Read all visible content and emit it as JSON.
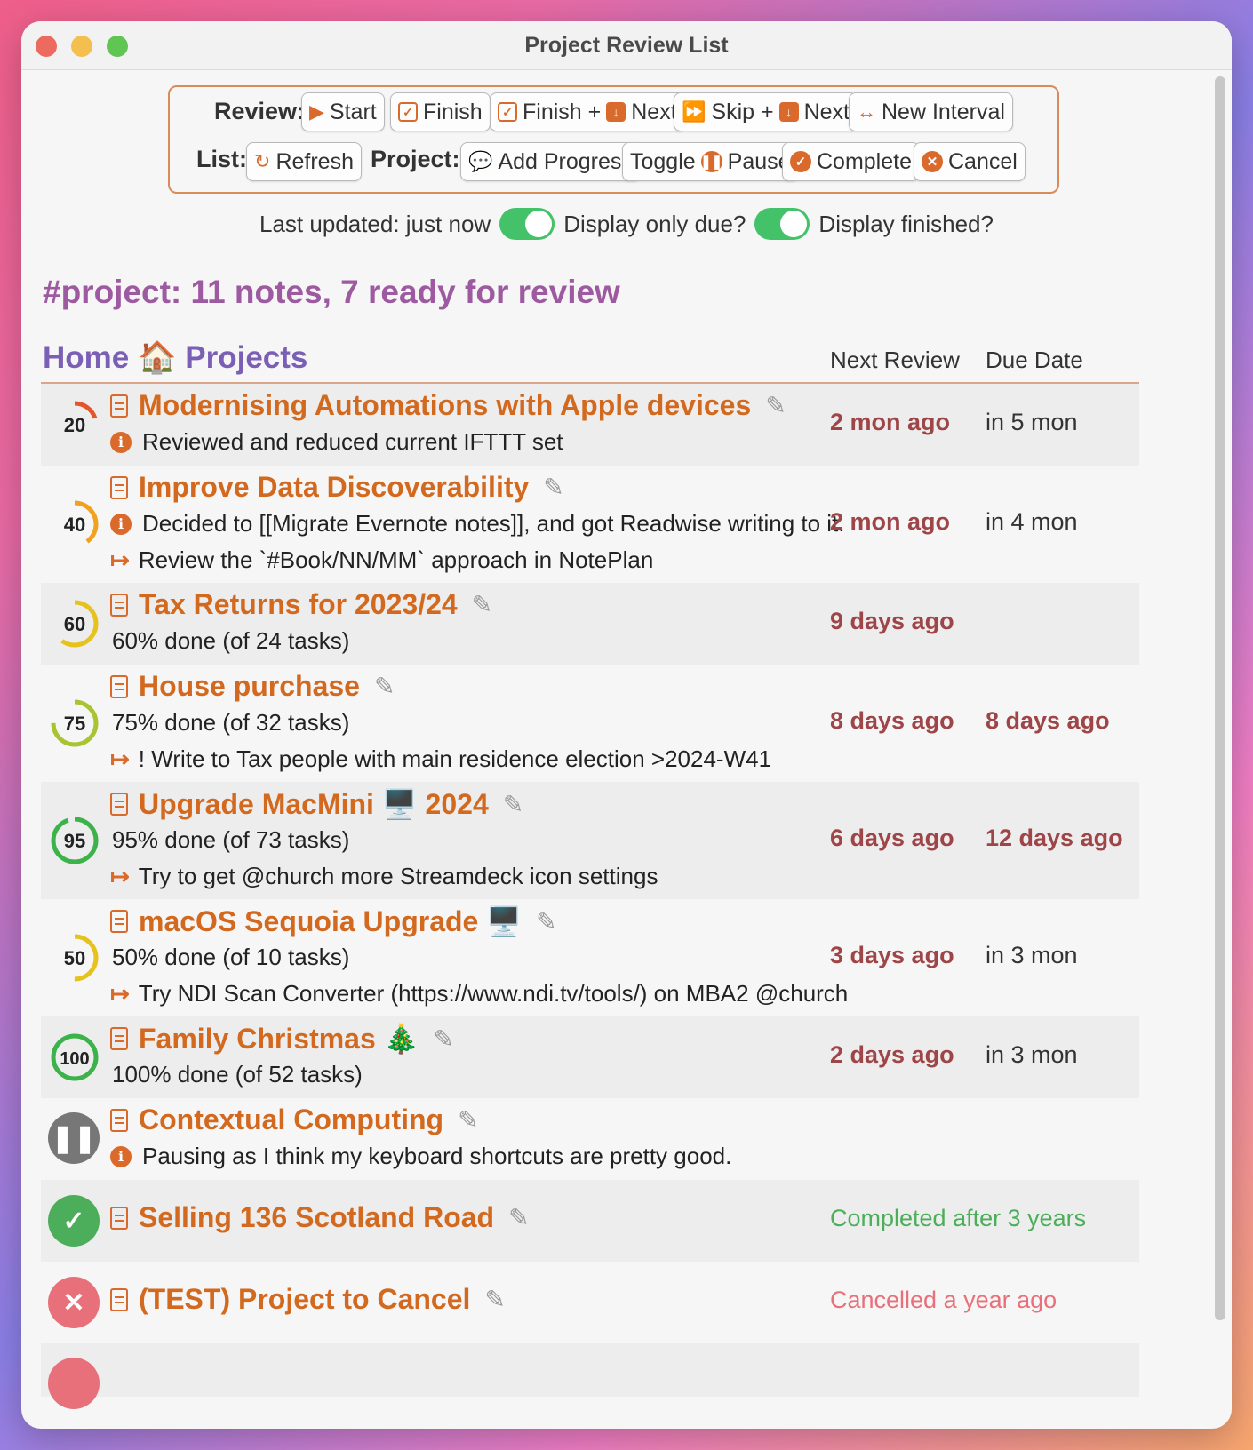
{
  "window": {
    "title": "Project Review List"
  },
  "toolbar": {
    "review_label": "Review:",
    "list_label": "List:",
    "project_label": "Project::",
    "start": "Start",
    "finish": "Finish",
    "finish_next": "Finish + ",
    "next": "Next",
    "skip_next": "Skip + ",
    "next2": "Next",
    "new_interval": "New Interval",
    "refresh": "Refresh",
    "add_progress": "Add Progress",
    "toggle": "Toggle",
    "pause": "Pause",
    "complete": "Complete",
    "cancel": "Cancel"
  },
  "status": {
    "last_updated": "Last updated: just now",
    "display_only_due": "Display only due?",
    "display_finished": "Display finished?",
    "display_only_due_on": true,
    "display_finished_on": true
  },
  "summary": "#project: 11 notes, 7 ready for review",
  "folder": {
    "name": "Home 🏠 Projects"
  },
  "columns": {
    "next_review": "Next Review",
    "due_date": "Due Date"
  },
  "projects": [
    {
      "title": "Modernising Automations with Apple devices",
      "progress": 20,
      "note": "Reviewed and reduced current IFTTT set",
      "next_review": "2 mon ago",
      "due": "in 5 mon"
    },
    {
      "title": "Improve Data Discoverability",
      "progress": 40,
      "note": "Decided to [[Migrate Evernote notes]], and got Readwise writing to it.",
      "next_action": "Review the `#Book/NN/MM` approach in NotePlan",
      "next_review": "2 mon ago",
      "due": "in 4 mon"
    },
    {
      "title": "Tax Returns for 2023/24",
      "progress": 60,
      "progress_text": "60% done (of 24 tasks)",
      "next_review": "9 days ago",
      "due": ""
    },
    {
      "title": "House purchase",
      "progress": 75,
      "progress_text": "75% done (of 32 tasks)",
      "next_action": "! Write to Tax people with main residence election >2024-W41",
      "next_review": "8 days ago",
      "due": "8 days ago"
    },
    {
      "title": "Upgrade MacMini 🖥️ 2024",
      "progress": 95,
      "progress_text": "95% done (of 73 tasks)",
      "next_action": "Try to get @church more Streamdeck icon settings",
      "next_review": "6 days ago",
      "due": "12 days ago"
    },
    {
      "title": "macOS Sequoia Upgrade 🖥️",
      "progress": 50,
      "progress_text": "50% done (of 10 tasks)",
      "next_action": "Try NDI Scan Converter (https://www.ndi.tv/tools/) on MBA2 @church",
      "next_review": "3 days ago",
      "due": "in 3 mon"
    },
    {
      "title": "Family Christmas 🎄",
      "progress": 100,
      "progress_text": "100% done (of 52 tasks)",
      "next_review": "2 days ago",
      "due": "in 3 mon"
    },
    {
      "title": "Contextual Computing",
      "state": "paused",
      "note": "Pausing as I think my keyboard shortcuts are pretty good."
    },
    {
      "title": "Selling 136 Scotland Road",
      "state": "completed",
      "status_text": "Completed after 3 years"
    },
    {
      "title": "(TEST) Project to Cancel",
      "state": "cancelled",
      "status_text": "Cancelled a year ago"
    }
  ],
  "colors": {
    "accent": "#d96a2b",
    "title": "#d2691e",
    "overdue": "#9e4548",
    "summary": "#9d5aa0",
    "folder": "#7a5fb5",
    "completed": "#4cae5a",
    "cancelled": "#e8707a",
    "paused": "#777777",
    "toggle_on": "#44c26a"
  },
  "icons": {
    "start": "play-icon",
    "finish": "calendar-check-icon",
    "next": "calendar-next-icon",
    "skip": "fast-forward-icon",
    "new_interval": "left-right-arrow-icon",
    "refresh": "refresh-icon",
    "add_progress": "comment-icon",
    "pause": "pause-icon",
    "complete": "check-circle-icon",
    "cancel": "x-circle-icon",
    "note": "document-icon",
    "edit": "edit-icon",
    "info": "info-icon",
    "next_action": "next-action-arrow-icon"
  }
}
